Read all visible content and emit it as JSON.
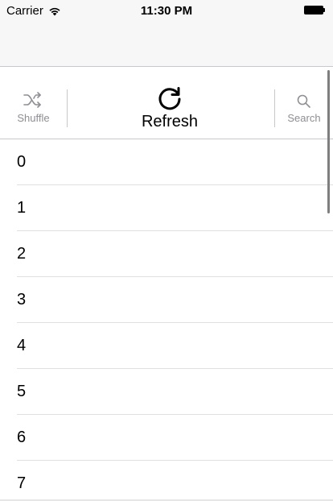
{
  "status_bar": {
    "carrier": "Carrier",
    "time": "11:30 PM",
    "wifi_icon": "wifi-icon",
    "battery_icon": "battery-icon"
  },
  "toolbar": {
    "shuffle": {
      "label": "Shuffle",
      "icon": "shuffle-icon"
    },
    "refresh": {
      "label": "Refresh",
      "icon": "refresh-icon"
    },
    "search": {
      "label": "Search",
      "icon": "search-icon"
    }
  },
  "list": {
    "items": [
      "0",
      "1",
      "2",
      "3",
      "4",
      "5",
      "6",
      "7"
    ]
  },
  "colors": {
    "toolbar_inactive": "#8e8e93",
    "separator": "#c8c7cc",
    "nav_background": "#f7f7f7"
  }
}
